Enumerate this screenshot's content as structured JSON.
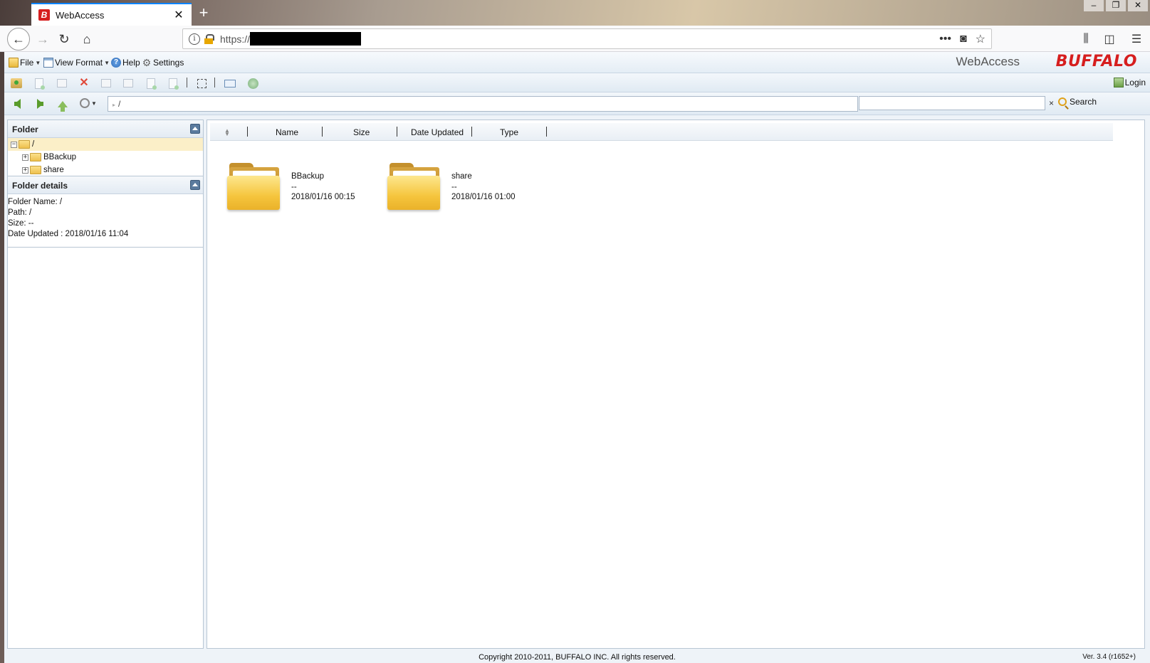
{
  "browser": {
    "tab_title": "WebAccess",
    "tab_favicon": "B",
    "new_tab": "+",
    "url_prefix": "https://",
    "window_controls": [
      "–",
      "❐",
      "✕"
    ]
  },
  "app": {
    "menu": {
      "file": "File",
      "view_format": "View Format",
      "help": "Help",
      "settings": "Settings"
    },
    "brand_text": "WebAccess",
    "brand_logo": "BUFFALO",
    "login": "Login",
    "path_value": "/",
    "search_value": "",
    "search_clear": "×",
    "search_button": "Search"
  },
  "folder_panel": {
    "title": "Folder",
    "tree": [
      {
        "label": "/",
        "expander": "−",
        "level": 0,
        "selected": true
      },
      {
        "label": "BBackup",
        "expander": "+",
        "level": 1
      },
      {
        "label": "share",
        "expander": "+",
        "level": 1
      }
    ]
  },
  "details_panel": {
    "title": "Folder details",
    "lines": [
      "Folder Name: /",
      "Path: /",
      "Size: --",
      "Date Updated : 2018/01/16 11:04"
    ]
  },
  "columns": [
    "Name",
    "Size",
    "Date Updated",
    "Type"
  ],
  "items": [
    {
      "name": "BBackup",
      "size": "--",
      "date": "2018/01/16 00:15"
    },
    {
      "name": "share",
      "size": "--",
      "date": "2018/01/16 01:00"
    }
  ],
  "footer": {
    "copyright": "Copyright 2010-2011, BUFFALO INC. All rights reserved.",
    "version": "Ver. 3.4 (r1652+)"
  },
  "colors": {
    "accent_tab": "#0a84ff",
    "brand_red": "#d61e1e",
    "selected_row": "#fbefc8"
  }
}
